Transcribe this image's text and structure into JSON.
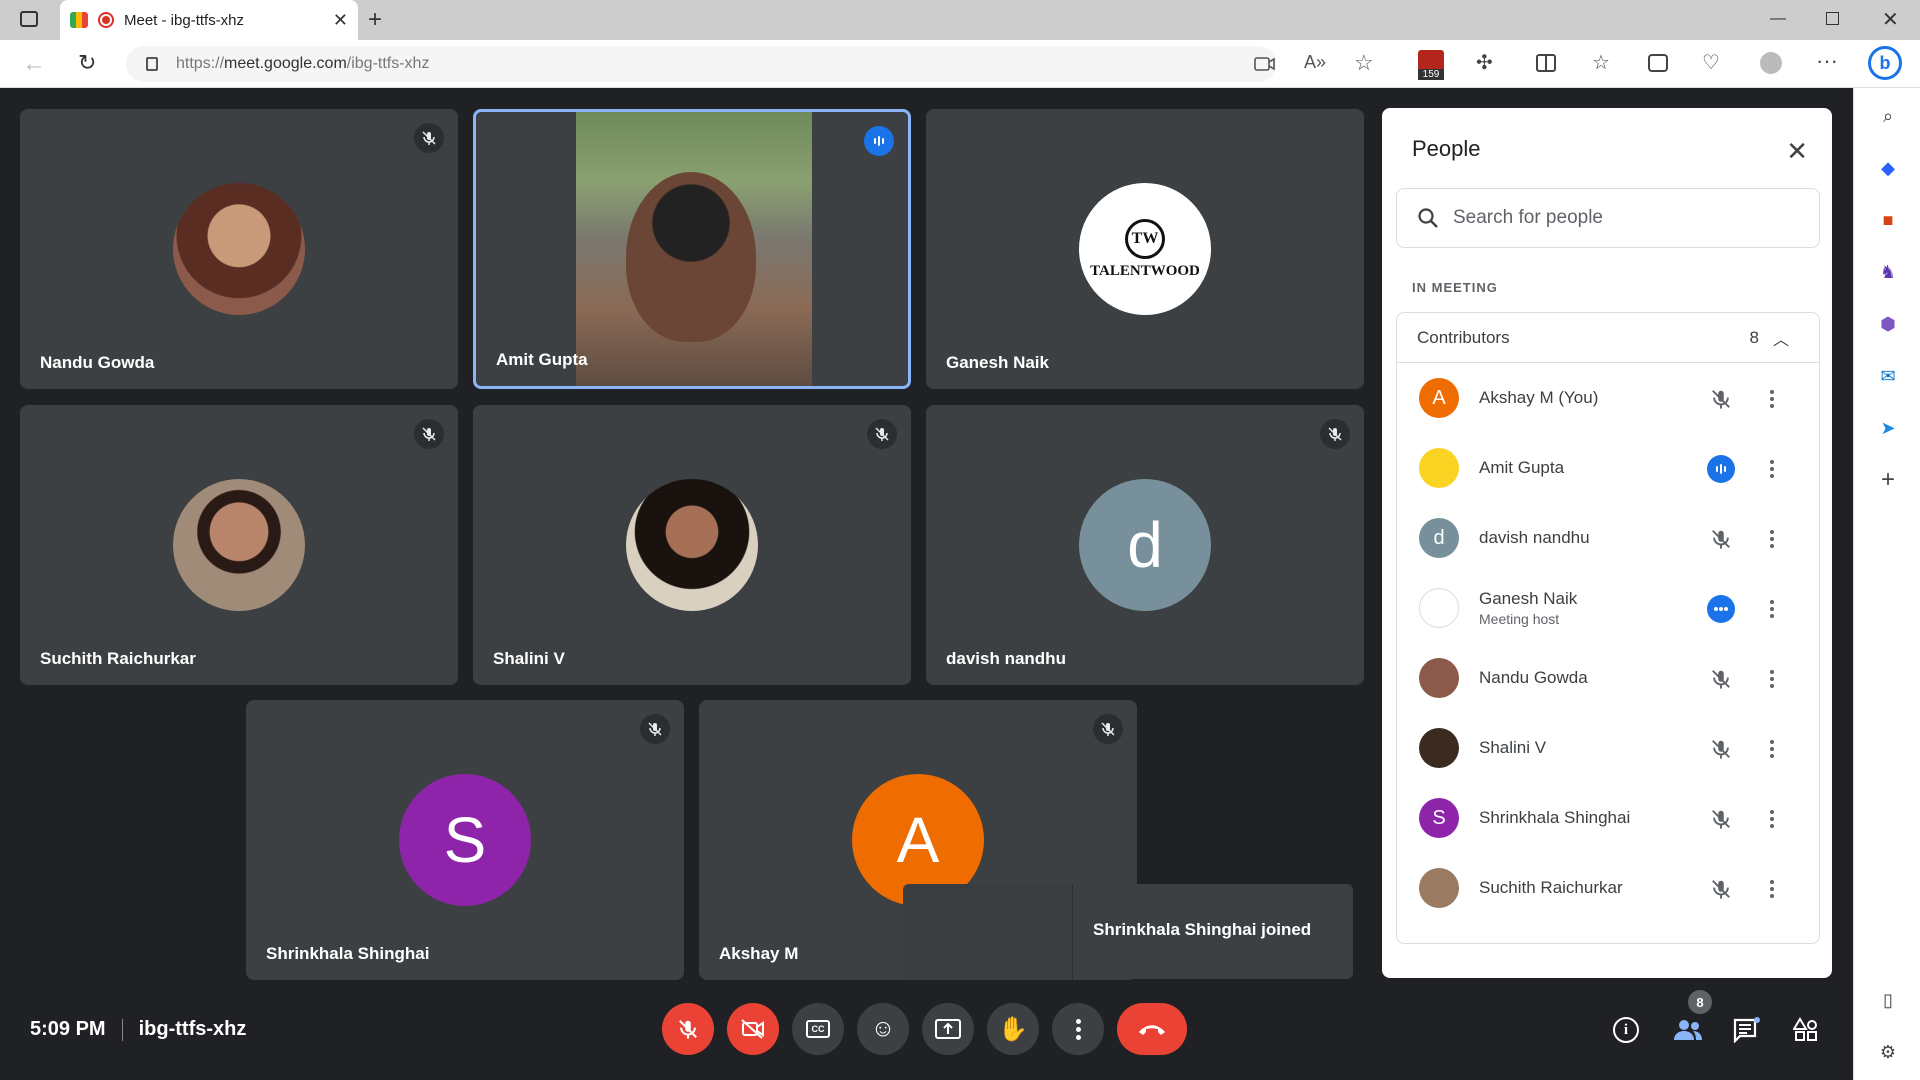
{
  "browser": {
    "tab_title": "Meet - ibg-ttfs-xhz",
    "url_prefix": "https://",
    "url_host": "meet.google.com",
    "url_path": "/ibg-ttfs-xhz",
    "extension_badge": "159"
  },
  "tiles": [
    {
      "name": "Nandu Gowda",
      "avatar_letter": "",
      "avatar_color": "#8b5a4a",
      "muted": true
    },
    {
      "name": "Amit Gupta",
      "avatar_letter": "",
      "avatar_color": "#6b6b60",
      "muted": false,
      "speaking": true
    },
    {
      "name": "Ganesh Naik",
      "avatar_letter": "",
      "avatar_color": "#ffffff",
      "logo_text": "TALENTWOOD",
      "muted": false
    },
    {
      "name": "Suchith Raichurkar",
      "avatar_letter": "",
      "avatar_color": "#9a7a60",
      "muted": true
    },
    {
      "name": "Shalini V",
      "avatar_letter": "",
      "avatar_color": "#3a2a20",
      "muted": true
    },
    {
      "name": "davish nandhu",
      "avatar_letter": "d",
      "avatar_color": "#78909c",
      "muted": true
    },
    {
      "name": "Shrinkhala Shinghai",
      "avatar_letter": "S",
      "avatar_color": "#8e24aa",
      "muted": true
    },
    {
      "name": "Akshay M",
      "avatar_letter": "A",
      "avatar_color": "#ef6c00",
      "muted": true
    }
  ],
  "toast": {
    "message": "Shrinkhala Shinghai joined"
  },
  "people_panel": {
    "title": "People",
    "search_placeholder": "Search for people",
    "section_label": "IN MEETING",
    "group_label": "Contributors",
    "group_count": "8",
    "participants": [
      {
        "name": "Akshay M (You)",
        "sub": "",
        "letter": "A",
        "color": "#ef6c00",
        "mic": "muted"
      },
      {
        "name": "Amit Gupta",
        "sub": "",
        "letter": "",
        "color": "#f9d423",
        "mic": "speaking"
      },
      {
        "name": "davish nandhu",
        "sub": "",
        "letter": "d",
        "color": "#78909c",
        "mic": "muted"
      },
      {
        "name": "Ganesh Naik",
        "sub": "Meeting host",
        "letter": "",
        "color": "#ffffff",
        "mic": "more"
      },
      {
        "name": "Nandu Gowda",
        "sub": "",
        "letter": "",
        "color": "#8b5a4a",
        "mic": "muted"
      },
      {
        "name": "Shalini V",
        "sub": "",
        "letter": "",
        "color": "#3a2a20",
        "mic": "muted"
      },
      {
        "name": "Shrinkhala Shinghai",
        "sub": "",
        "letter": "S",
        "color": "#8e24aa",
        "mic": "muted"
      },
      {
        "name": "Suchith Raichurkar",
        "sub": "",
        "letter": "",
        "color": "#9a7a60",
        "mic": "muted"
      }
    ]
  },
  "bottom_bar": {
    "time": "5:09 PM",
    "meeting_code": "ibg-ttfs-xhz",
    "people_count": "8"
  }
}
